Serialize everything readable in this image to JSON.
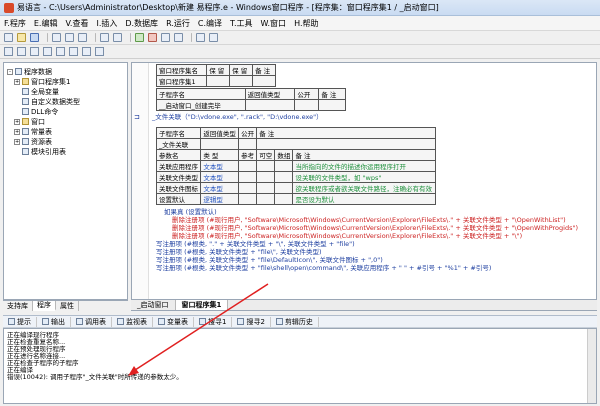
{
  "window": {
    "title": "易语言 - C:\\Users\\Administrator\\Desktop\\新建 易程序.e - Windows窗口程序 - [程序集：窗口程序集1 / _启动窗口]"
  },
  "menu": [
    "F.程序",
    "E.编辑",
    "V.查看",
    "I.插入",
    "D.数据库",
    "R.运行",
    "C.编译",
    "T.工具",
    "W.窗口",
    "H.帮助"
  ],
  "sidebar": {
    "items": [
      "程序数据",
      "窗口程序集1",
      "全局变量",
      "自定义数据类型",
      "DLL命令",
      "窗口",
      "常量表",
      "资源表",
      "模块引用表"
    ],
    "tabs": [
      "支持库",
      "程序",
      "属性"
    ]
  },
  "editor": {
    "assembly_table": {
      "headers": [
        "窗口程序集名",
        "保 留",
        "保 留",
        "备 注"
      ],
      "row": [
        "窗口程序集1",
        "",
        "",
        ""
      ]
    },
    "sub_table": {
      "headers": [
        "子程序名",
        "返回值类型",
        "公开",
        "备 注"
      ],
      "row": [
        "__启动窗口_创建完毕",
        "",
        "",
        ""
      ]
    },
    "call_line": "_文件关联（\"D:\\vdone.exe\", \".rack\", \"D:\\vdone.exe\"）",
    "file_sub": {
      "headers": [
        "子程序名",
        "返回值类型",
        "公开",
        "备 注"
      ],
      "name": "_文件关联",
      "param_headers": [
        "参数名",
        "类 型",
        "参考",
        "可空",
        "数组",
        "备 注"
      ],
      "params": [
        [
          "关联应用程序",
          "文本型",
          "",
          "",
          "",
          "当所指向的文件的描述你运用程序打开"
        ],
        [
          "关联文件类型",
          "文本型",
          "",
          "",
          "",
          "设关联的文件类型，如 \"wps\""
        ],
        [
          "关联文件图标",
          "文本型",
          "",
          "",
          "",
          "欲关联程序或者欲关联文件路径，注确必有有效"
        ],
        [
          "设置默认",
          "逻辑型",
          "",
          "",
          "",
          "是否设为默认"
        ]
      ]
    },
    "code_lines": [
      "如果真 (设置默认)",
      "删除注册项 (#现行用户, \"Software\\Microsoft\\Windows\\CurrentVersion\\Explorer\\FileExts\\.\" + 关联文件类型 + \"\\OpenWithList\")",
      "删除注册项 (#现行用户, \"Software\\Microsoft\\Windows\\CurrentVersion\\Explorer\\FileExts\\.\" + 关联文件类型 + \"\\OpenWithProgids\")",
      "删除注册项 (#现行用户, \"Software\\Microsoft\\Windows\\CurrentVersion\\Explorer\\FileExts\\.\" + 关联文件类型 + \"\\\")",
      "写注册项 (#根类, \".\" + 关联文件类型 + \"\\\", 关联文件类型 + \"file\")",
      "写注册项 (#根类, 关联文件类型 + \"file\\\", 关联文件类型)",
      "写注册项 (#根类, 关联文件类型 + \"file\\DefaultIcon\\\", 关联文件图标 + \",0\")",
      "写注册项 (#根类, 关联文件类型 + \"file\\shell\\open\\command\\\", 关联应用程序 + \" \" + #引号 + \"%1\" + #引号)"
    ],
    "tabs": [
      "_启动窗口",
      "窗口程序集1"
    ]
  },
  "output": {
    "tabs": [
      "提示",
      "输出",
      "调用表",
      "监视表",
      "变量表",
      "搜寻1",
      "搜寻2",
      "剪辑历史"
    ],
    "lines": [
      "正在编译现行程序",
      "正在检查重复名称...",
      "正在预处理现行程序",
      "正在进行名称连接...",
      "正在检查子程序的子程序",
      "正在编译",
      "错误(10042): 调用子程序\"_文件关联\"时所传递的参数太少。"
    ]
  },
  "colors": {
    "annotation_arrow": "#e02020"
  }
}
